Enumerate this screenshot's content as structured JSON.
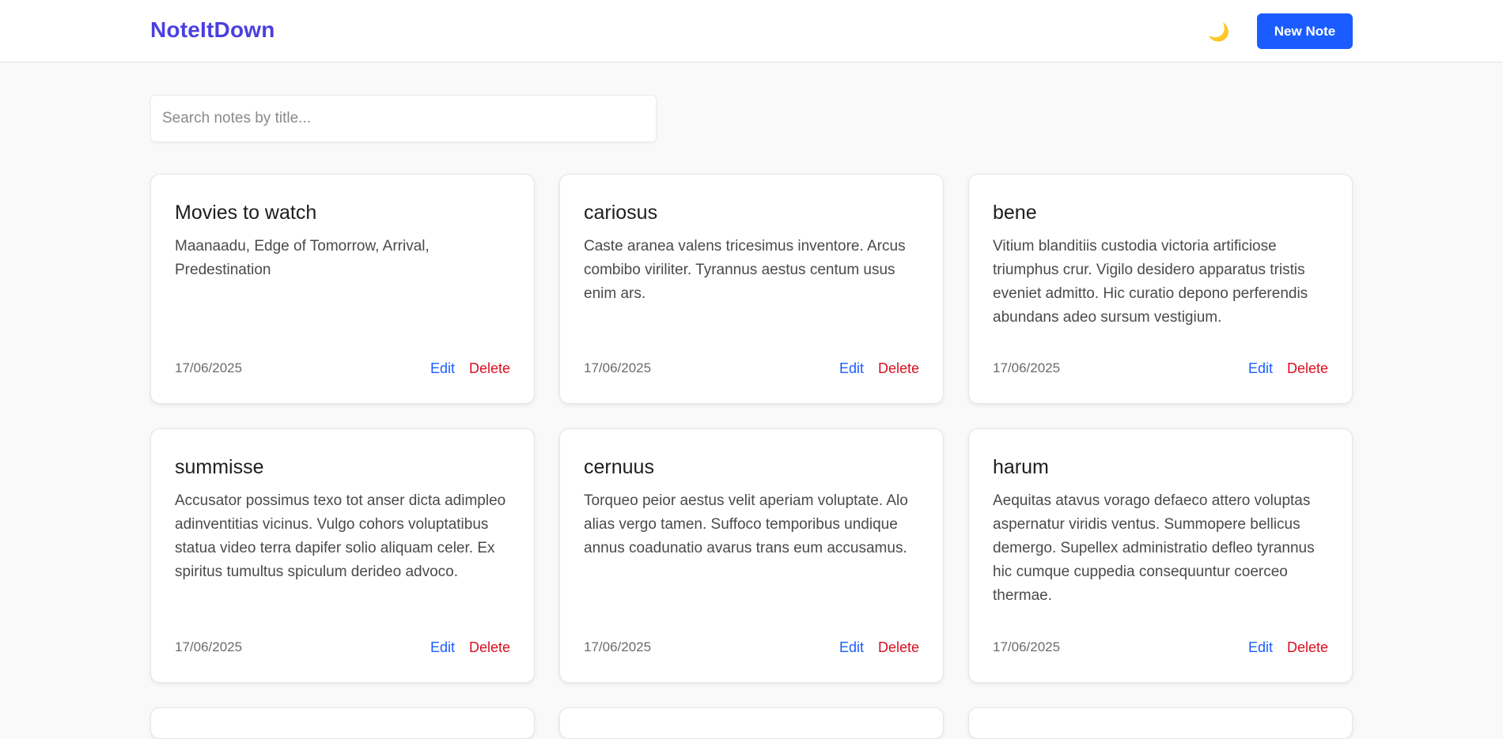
{
  "header": {
    "logo": "NoteItDown",
    "theme_toggle_icon": "🌙",
    "new_note_label": "New Note"
  },
  "search": {
    "placeholder": "Search notes by title...",
    "value": ""
  },
  "notes": [
    {
      "title": "Movies to watch",
      "body": "Maanaadu, Edge of Tomorrow, Arrival, Predestination",
      "date": "17/06/2025",
      "edit_label": "Edit",
      "delete_label": "Delete"
    },
    {
      "title": "cariosus",
      "body": "Caste aranea valens tricesimus inventore. Arcus combibo viriliter. Tyrannus aestus centum usus enim ars.",
      "date": "17/06/2025",
      "edit_label": "Edit",
      "delete_label": "Delete"
    },
    {
      "title": "bene",
      "body": "Vitium blanditiis custodia victoria artificiose triumphus crur. Vigilo desidero apparatus tristis eveniet admitto. Hic curatio depono perferendis abundans adeo sursum vestigium.",
      "date": "17/06/2025",
      "edit_label": "Edit",
      "delete_label": "Delete"
    },
    {
      "title": "summisse",
      "body": "Accusator possimus texo tot anser dicta adimpleo adinventitias vicinus. Vulgo cohors voluptatibus statua video terra dapifer solio aliquam celer. Ex spiritus tumultus spiculum derideo advoco.",
      "date": "17/06/2025",
      "edit_label": "Edit",
      "delete_label": "Delete"
    },
    {
      "title": "cernuus",
      "body": "Torqueo peior aestus velit aperiam voluptate. Alo alias vergo tamen. Suffoco temporibus undique annus coadunatio avarus trans eum accusamus.",
      "date": "17/06/2025",
      "edit_label": "Edit",
      "delete_label": "Delete"
    },
    {
      "title": "harum",
      "body": "Aequitas atavus vorago defaeco attero voluptas aspernatur viridis ventus. Summopere bellicus demergo. Supellex administratio defleo tyrannus hic cumque cuppedia consequuntur coerceo thermae.",
      "date": "17/06/2025",
      "edit_label": "Edit",
      "delete_label": "Delete"
    }
  ],
  "colors": {
    "brand": "#4a3fe0",
    "primary_button": "#1a5cff",
    "edit_link": "#1a5cff",
    "delete_link": "#d80f1f"
  }
}
